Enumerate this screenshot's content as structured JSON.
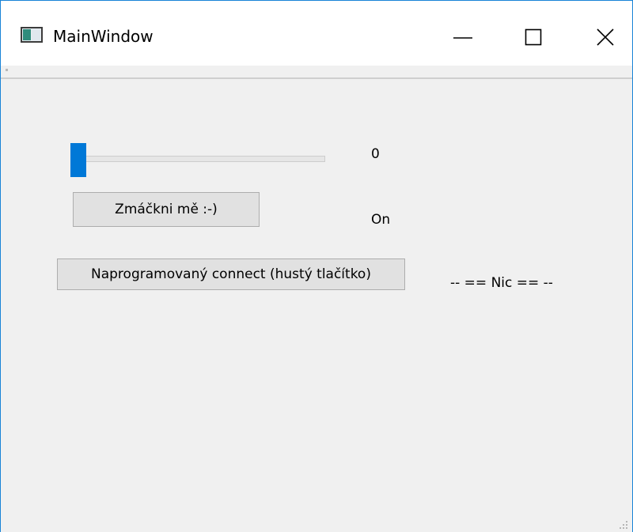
{
  "window": {
    "title": "MainWindow",
    "icon": "app-window-icon",
    "controls": {
      "minimize_icon": "minimize-icon",
      "maximize_icon": "maximize-icon",
      "close_icon": "close-icon"
    }
  },
  "slider": {
    "min": 0,
    "max": 100,
    "value": 0,
    "accent_color": "#0078d7"
  },
  "labels": {
    "value": "0",
    "state": "On",
    "nic": "-- == Nic == --"
  },
  "buttons": {
    "press_label": "Zmáčkni mě :-)",
    "connect_label": "Naprogramovaný connect (hustý tlačítko)"
  }
}
